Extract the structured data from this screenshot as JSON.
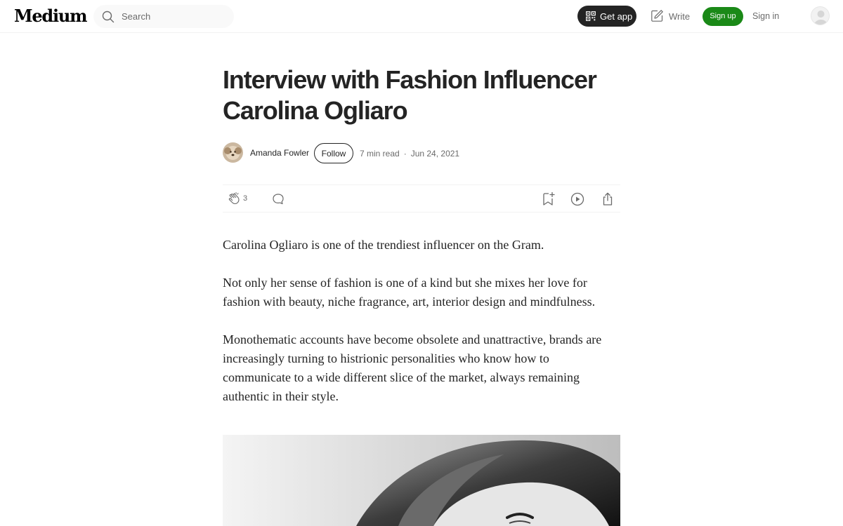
{
  "header": {
    "logo": "Medium",
    "search_placeholder": "Search",
    "get_app_label": "Get app",
    "write_label": "Write",
    "sign_up_label": "Sign up",
    "sign_in_label": "Sign in"
  },
  "article": {
    "title": "Interview with Fashion Influencer Carolina Ogliaro",
    "author": "Amanda Fowler",
    "follow_label": "Follow",
    "read_time": "7 min read",
    "date": "Jun 24, 2021",
    "clap_count": "3",
    "paragraphs": [
      "Carolina Ogliaro is one of the trendiest influencer on the Gram.",
      "Not only her sense of fashion is one of a kind but she mixes her love for fashion with beauty, niche fragrance, art, interior design and mindfulness.",
      "Monothematic accounts have become obsolete and unattractive, brands are increasingly turning to histrionic personalities who know how to communicate to a wide different slice of the market, always remaining authentic in their style."
    ]
  },
  "colors": {
    "text": "#242424",
    "muted": "#6b6b6b",
    "signup_green": "#1a8917",
    "getapp_dark": "#242424"
  },
  "icons": {
    "search": "search-icon",
    "qr": "qr-code-icon",
    "write": "write-icon",
    "clap": "clap-icon",
    "comment": "comment-icon",
    "bookmark": "bookmark-icon",
    "listen": "play-icon",
    "share": "share-icon"
  }
}
